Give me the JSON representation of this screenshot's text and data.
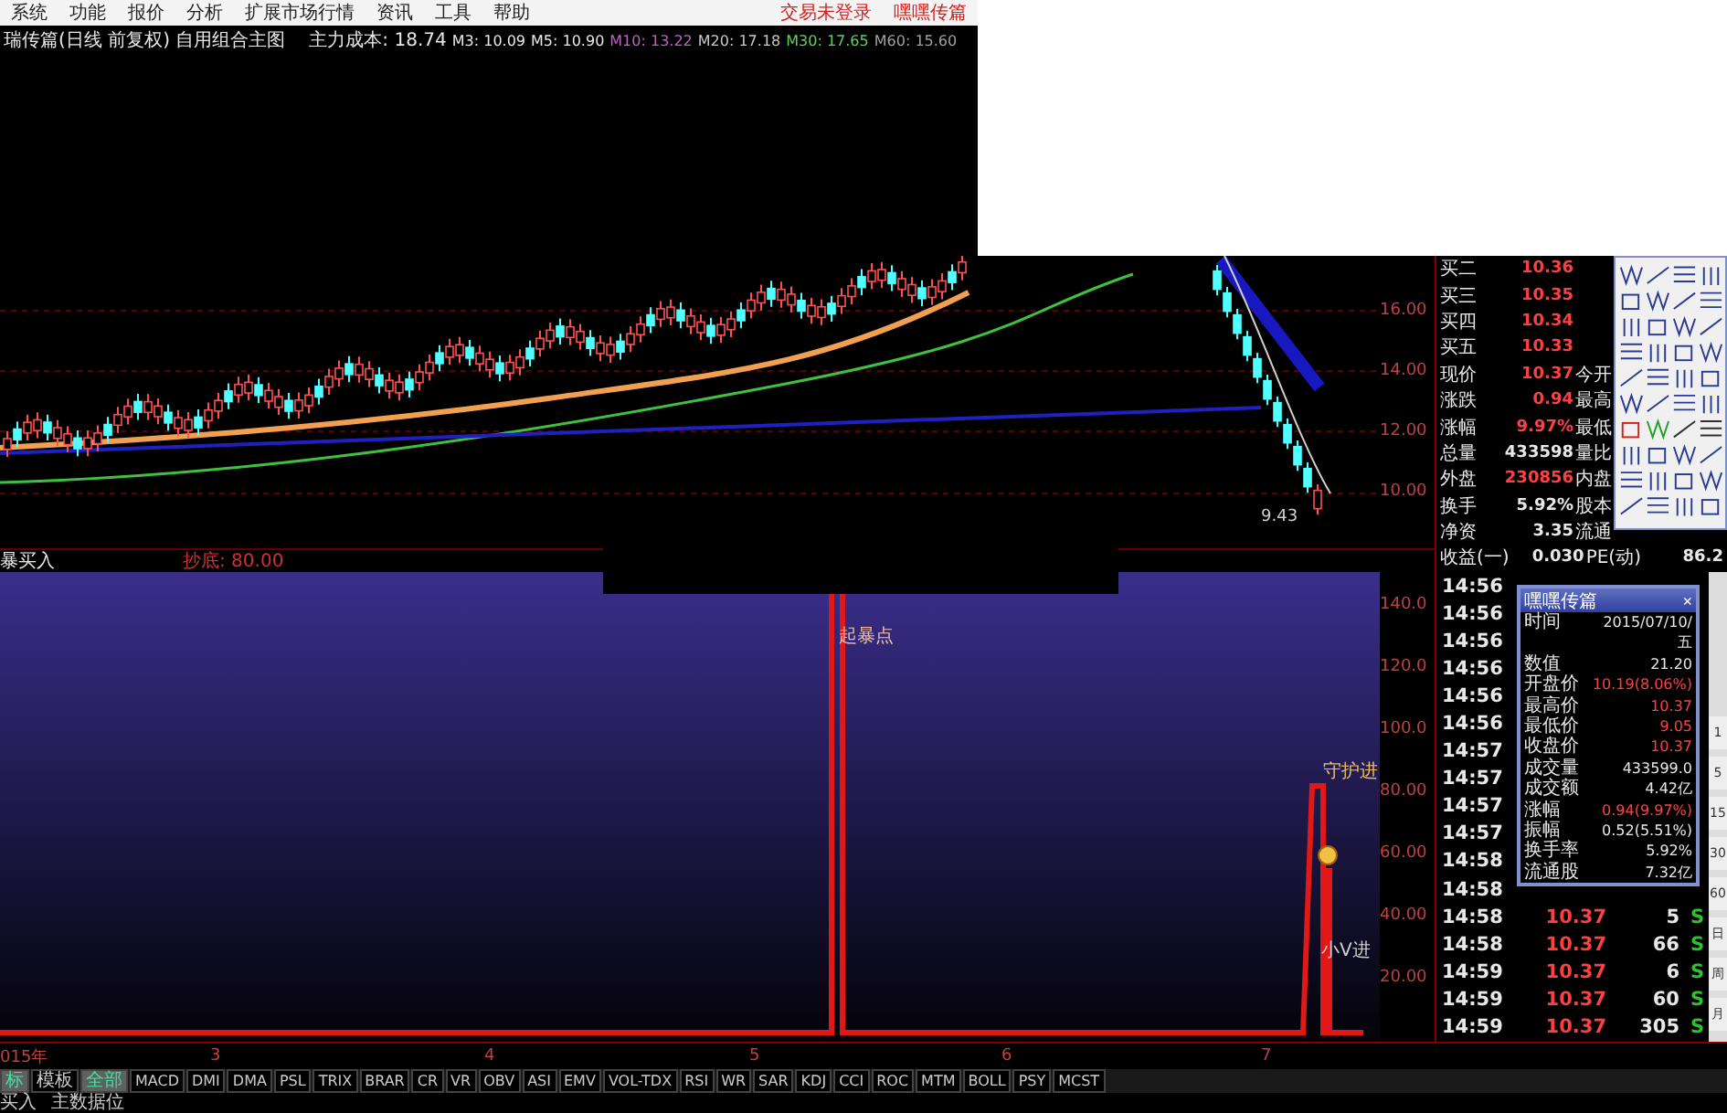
{
  "menu": {
    "items": [
      "系统",
      "功能",
      "报价",
      "分析",
      "扩展市场行情",
      "资讯",
      "工具",
      "帮助"
    ],
    "right": [
      "交易未登录",
      "嘿嘿传篇"
    ]
  },
  "info_bar": {
    "title": "瑞传篇(日线 前复权) 自用组合主图",
    "indicators": [
      {
        "label": "主力成本:",
        "value": "18.74",
        "color": "#e8e8e8"
      },
      {
        "label": "M3:",
        "value": "10.09",
        "color": "#e8e8e8"
      },
      {
        "label": "M5:",
        "value": "10.90",
        "color": "#e8e8e8"
      },
      {
        "label": "M10:",
        "value": "13.22",
        "color": "#c060c0"
      },
      {
        "label": "M20:",
        "value": "17.18",
        "color": "#c8c8c8"
      },
      {
        "label": "M30:",
        "value": "17.65",
        "color": "#60d060"
      },
      {
        "label": "M60:",
        "value": "15.60",
        "color": "#a0a0a0"
      }
    ]
  },
  "price_chart": {
    "axis": [
      "16.00",
      "14.00",
      "12.00",
      "10.00"
    ],
    "low_label": "9.43"
  },
  "indicator_bar": {
    "name": "暴买入",
    "reading": "抄底: 80.00"
  },
  "indicator_chart": {
    "axis": [
      "140.0",
      "120.0",
      "100.0",
      "80.00",
      "60.00",
      "40.00",
      "20.00"
    ],
    "spike_label": "起暴点",
    "step_label": "守护进",
    "small_label": "小V进"
  },
  "quote": {
    "rows": [
      {
        "label": "买二",
        "value": "10.36",
        "color": "#ff4040"
      },
      {
        "label": "买三",
        "value": "10.35",
        "color": "#ff4040"
      },
      {
        "label": "买四",
        "value": "10.34",
        "color": "#ff4040"
      },
      {
        "label": "买五",
        "value": "10.33",
        "color": "#ff4040"
      },
      {
        "label": "现价",
        "value": "10.37",
        "color": "#ff4040",
        "label2": "今开"
      },
      {
        "label": "涨跌",
        "value": "0.94",
        "color": "#ff4040",
        "label2": "最高"
      },
      {
        "label": "涨幅",
        "value": "9.97%",
        "color": "#ff4040",
        "label2": "最低"
      },
      {
        "label": "总量",
        "value": "433598",
        "color": "#e8e8e8",
        "label2": "量比"
      },
      {
        "label": "外盘",
        "value": "230856",
        "color": "#ff4040",
        "label2": "内盘"
      },
      {
        "label": "换手",
        "value": "5.92%",
        "color": "#e8e8e8",
        "label2": "股本"
      },
      {
        "label": "净资",
        "value": "3.35",
        "color": "#e8e8e8",
        "label2": "流通"
      },
      {
        "label": "收益(一)",
        "value": "0.030",
        "color": "#e8e8e8",
        "label2": "PE(动)",
        "value2": "86.2"
      }
    ]
  },
  "ticks": [
    {
      "time": "14:56"
    },
    {
      "time": "14:56"
    },
    {
      "time": "14:56"
    },
    {
      "time": "14:56"
    },
    {
      "time": "14:56"
    },
    {
      "time": "14:56"
    },
    {
      "time": "14:57"
    },
    {
      "time": "14:57"
    },
    {
      "time": "14:57"
    },
    {
      "time": "14:57"
    },
    {
      "time": "14:58"
    },
    {
      "time": "14:58"
    },
    {
      "time": "14:58",
      "price": "10.37",
      "volume": "5",
      "side": "S"
    },
    {
      "time": "14:58",
      "price": "10.37",
      "volume": "66",
      "side": "S"
    },
    {
      "time": "14:59",
      "price": "10.37",
      "volume": "6",
      "side": "S"
    },
    {
      "time": "14:59",
      "price": "10.37",
      "volume": "60",
      "side": "S"
    },
    {
      "time": "14:59",
      "price": "10.37",
      "volume": "305",
      "side": "S"
    }
  ],
  "popup": {
    "title": "嘿嘿传篇",
    "close": "×",
    "rows": [
      {
        "label": "时间",
        "value": "2015/07/10/五",
        "color": "#e8e8e8"
      },
      {
        "label": "数值",
        "value": "21.20",
        "color": "#e8e8e8"
      },
      {
        "label": "开盘价",
        "value": "10.19(8.06%)",
        "color": "#ff4040"
      },
      {
        "label": "最高价",
        "value": "10.37",
        "color": "#ff4040"
      },
      {
        "label": "最低价",
        "value": "9.05",
        "color": "#ff4040"
      },
      {
        "label": "收盘价",
        "value": "10.37",
        "color": "#ff4040"
      },
      {
        "label": "成交量",
        "value": "433599.0",
        "color": "#e8e8e8"
      },
      {
        "label": "成交额",
        "value": "4.42亿",
        "color": "#e8e8e8"
      },
      {
        "label": "涨幅",
        "value": "0.94(9.97%)",
        "color": "#ff4040"
      },
      {
        "label": "振幅",
        "value": "0.52(5.51%)",
        "color": "#e8e8e8"
      },
      {
        "label": "换手率",
        "value": "5.92%",
        "color": "#e8e8e8"
      },
      {
        "label": "流通股",
        "value": "7.32亿",
        "color": "#e8e8e8"
      }
    ]
  },
  "periods": [
    "1",
    "5",
    "15",
    "30",
    "60",
    "日",
    "周",
    "月"
  ],
  "x_axis": [
    "015年",
    "3",
    "4",
    "5",
    "6",
    "7"
  ],
  "tabs": [
    {
      "label": "标",
      "selected": true
    },
    {
      "label": "模板",
      "selected": false
    },
    {
      "label": "全部",
      "selected": true
    },
    {
      "label": "MACD",
      "selected": false
    },
    {
      "label": "DMI",
      "selected": false
    },
    {
      "label": "DMA",
      "selected": false
    },
    {
      "label": "PSL",
      "selected": false
    },
    {
      "label": "TRIX",
      "selected": false
    },
    {
      "label": "BRAR",
      "selected": false
    },
    {
      "label": "CR",
      "selected": false
    },
    {
      "label": "VR",
      "selected": false
    },
    {
      "label": "OBV",
      "selected": false
    },
    {
      "label": "ASI",
      "selected": false
    },
    {
      "label": "EMV",
      "selected": false
    },
    {
      "label": "VOL-TDX",
      "selected": false
    },
    {
      "label": "RSI",
      "selected": false
    },
    {
      "label": "WR",
      "selected": false
    },
    {
      "label": "SAR",
      "selected": false
    },
    {
      "label": "KDJ",
      "selected": false
    },
    {
      "label": "CCI",
      "selected": false
    },
    {
      "label": "ROC",
      "selected": false
    },
    {
      "label": "MTM",
      "selected": false
    },
    {
      "label": "BOLL",
      "selected": false
    },
    {
      "label": "PSY",
      "selected": false
    },
    {
      "label": "MCST",
      "selected": false
    }
  ],
  "status": [
    "买入",
    "主数据位"
  ]
}
